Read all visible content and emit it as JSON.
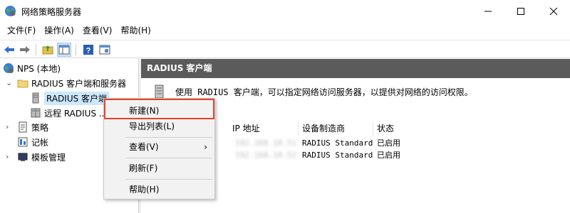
{
  "window": {
    "title": "网络策略服务器"
  },
  "menubar": [
    {
      "label": "文件(F)"
    },
    {
      "label": "操作(A)"
    },
    {
      "label": "查看(V)"
    },
    {
      "label": "帮助(H)"
    }
  ],
  "toolbar": {
    "icons": [
      "back-arrow-icon",
      "forward-arrow-icon",
      "folder-up-icon",
      "show-hide-tree-icon",
      "help-icon",
      "properties-icon"
    ]
  },
  "tree": {
    "root": "NPS (本地)",
    "radius_group": "RADIUS 客户端和服务器",
    "radius_clients": "RADIUS 客户端",
    "remote_radius": "远程 RADIUS ...",
    "policies": "策略",
    "accounting": "记帐",
    "templates": "模板管理"
  },
  "pane": {
    "header": "RADIUS 客户端",
    "description": "使用 RADIUS 客户端，可以指定网络访问服务器，以提供对网络的访问权限。",
    "columns": [
      "IP 地址",
      "设备制造商",
      "状态"
    ],
    "rows": [
      {
        "ip": "192.168.10.51",
        "vendor": "RADIUS Standard",
        "status": "已启用"
      },
      {
        "ip": "192.168.10.52",
        "vendor": "RADIUS Standard",
        "status": "已启用"
      }
    ]
  },
  "context_menu": {
    "new": "新建(N)",
    "export": "导出列表(L)",
    "view": "查看(V)",
    "refresh": "刷新(F)",
    "help": "帮助(H)",
    "submenu_arrow": "›"
  },
  "colors": {
    "pane_header": "#5b5b5b",
    "highlight": "#e8432b",
    "selection": "#cce8ff"
  }
}
